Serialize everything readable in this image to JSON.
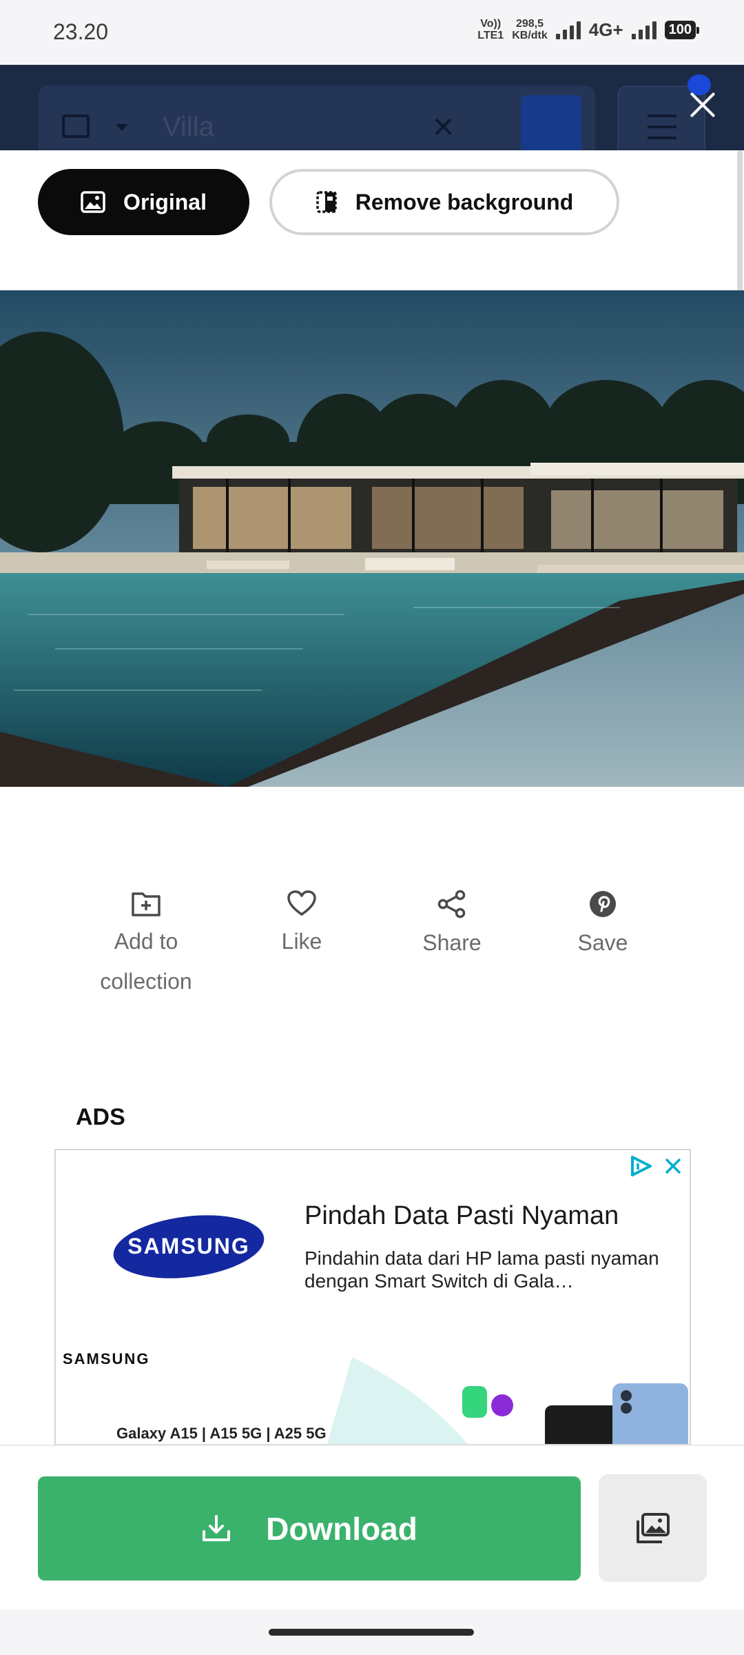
{
  "status_bar": {
    "time": "23.20",
    "volte_top": "Vo))",
    "volte_bottom": "LTE1",
    "speed_value": "298,5",
    "speed_unit": "KB/dtk",
    "network": "4G+",
    "battery": "100"
  },
  "search": {
    "query": "Villa",
    "icons": [
      "image-icon",
      "chevron-down-icon",
      "clear-icon",
      "search-icon",
      "filter-icon"
    ]
  },
  "toggle": {
    "original_label": "Original",
    "remove_bg_label": "Remove background"
  },
  "actions": {
    "collection_label_1": "Add to",
    "collection_label_2": "collection",
    "like_label": "Like",
    "share_label": "Share",
    "save_label": "Save"
  },
  "ads": {
    "section_label": "ADS",
    "brand": "SAMSUNG",
    "title": "Pindah Data Pasti Nyaman",
    "body": "Pindahin data dari HP lama pasti nyaman dengan Smart Switch di Gala…",
    "brand_small": "SAMSUNG",
    "models": "Galaxy A15 | A15 5G | A25 5G"
  },
  "footer": {
    "download_label": "Download"
  },
  "colors": {
    "download_green": "#3bb26b",
    "header_navy": "#1c2a46",
    "samsung_blue": "#1428a0",
    "adchoice_blue": "#00aecd"
  }
}
